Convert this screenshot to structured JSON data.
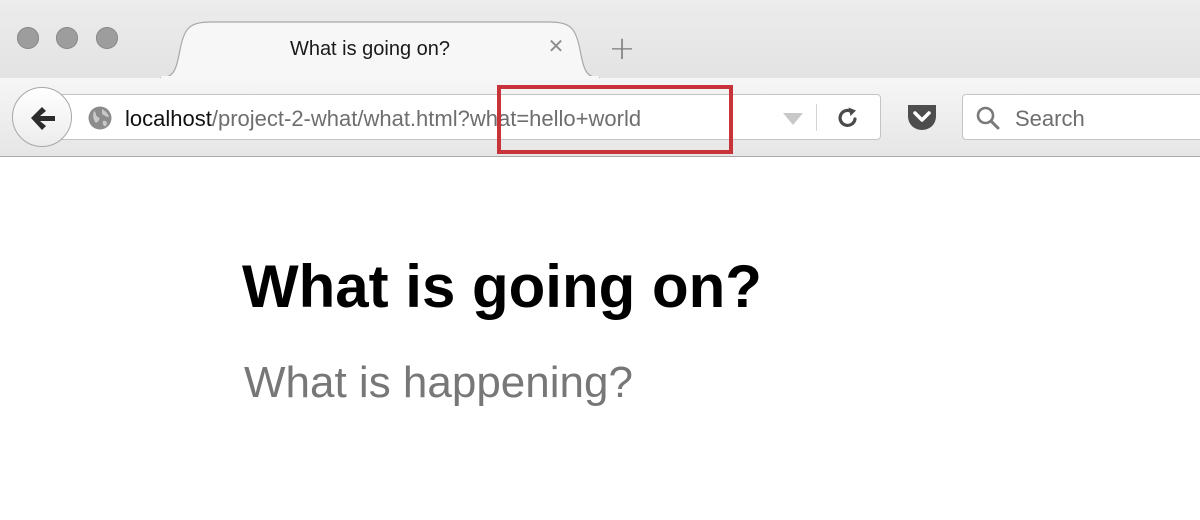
{
  "browser": {
    "tab": {
      "title": "What is going on?",
      "close_glyph": "✕"
    },
    "new_tab_glyph": "+",
    "url": {
      "host": "localhost",
      "path": "/project-2-what/what.html",
      "query": "?what=hello+world"
    },
    "search": {
      "placeholder": "Search"
    },
    "icons": {
      "back": "back-arrow-icon",
      "site": "globe-icon",
      "reload": "reload-icon",
      "pocket": "pocket-icon",
      "search": "search-icon"
    },
    "highlight_color": "#c8333a"
  },
  "page": {
    "heading": "What is going on?",
    "subheading": "What is happening?"
  }
}
